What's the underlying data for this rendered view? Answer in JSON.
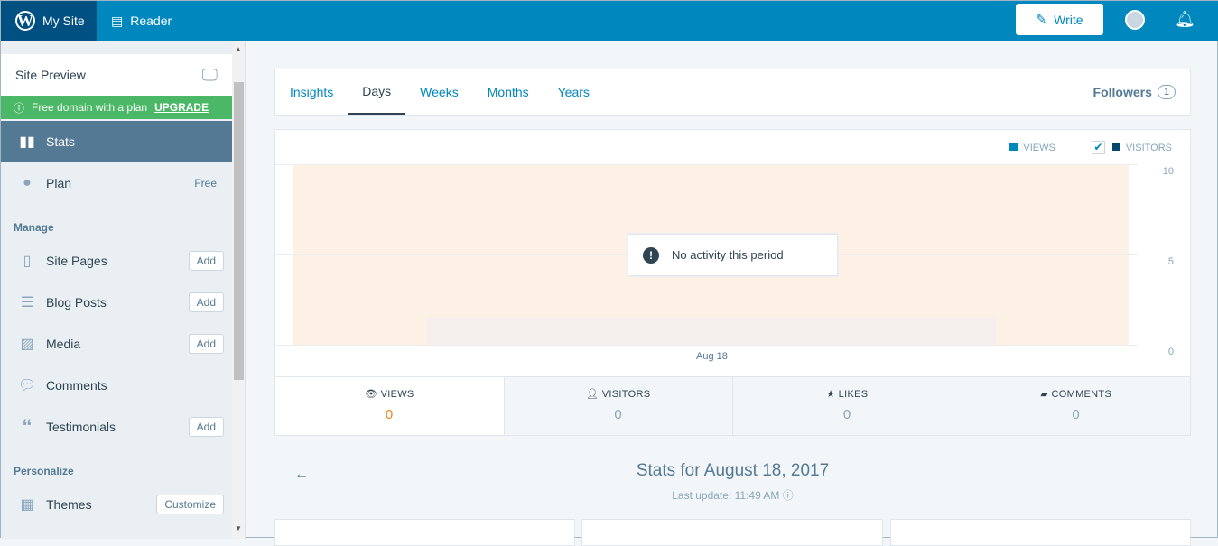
{
  "topbar": {
    "my_site": "My Site",
    "reader": "Reader",
    "write": "Write"
  },
  "sidebar": {
    "site_preview": "Site Preview",
    "promo": "Free domain with a plan",
    "upgrade": "UPGRADE",
    "stats": "Stats",
    "plan": "Plan",
    "plan_value": "Free",
    "manage": "Manage",
    "personalize": "Personalize",
    "items": [
      {
        "label": "Site Pages",
        "btn": "Add"
      },
      {
        "label": "Blog Posts",
        "btn": "Add"
      },
      {
        "label": "Media",
        "btn": "Add"
      },
      {
        "label": "Comments"
      },
      {
        "label": "Testimonials",
        "btn": "Add"
      }
    ],
    "themes": "Themes",
    "customize": "Customize"
  },
  "tabs": [
    "Insights",
    "Days",
    "Weeks",
    "Months",
    "Years"
  ],
  "followers": {
    "label": "Followers",
    "count": "1"
  },
  "chart_data": {
    "type": "bar",
    "legend": [
      "VIEWS",
      "VISITORS"
    ],
    "visitors_checked": true,
    "y_ticks": [
      "10",
      "5",
      "0"
    ],
    "ylim": [
      0,
      10
    ],
    "categories": [
      "Aug 18"
    ],
    "series": [
      {
        "name": "VIEWS",
        "values": [
          0
        ]
      },
      {
        "name": "VISITORS",
        "values": [
          0
        ]
      }
    ],
    "colors": {
      "views": "#0087be",
      "visitors": "#00476b"
    }
  },
  "empty_message": "No activity this period",
  "summary": [
    {
      "label": "VIEWS",
      "value": "0"
    },
    {
      "label": "VISITORS",
      "value": "0"
    },
    {
      "label": "LIKES",
      "value": "0"
    },
    {
      "label": "COMMENTS",
      "value": "0"
    }
  ],
  "period": {
    "title": "Stats for August 18, 2017",
    "updated": "Last update: 11:49 AM"
  }
}
